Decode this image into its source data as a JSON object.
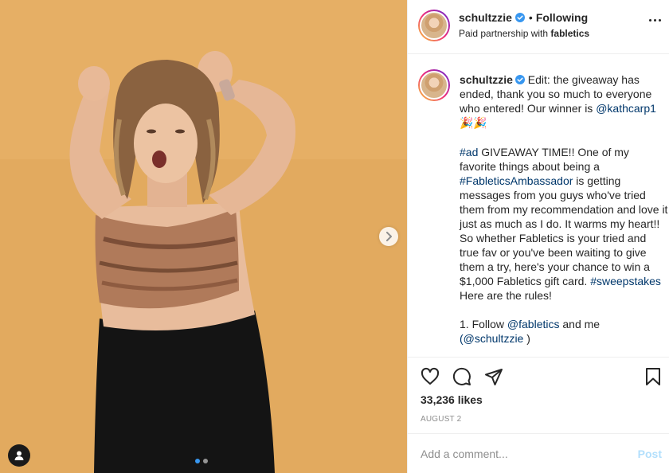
{
  "post": {
    "username": "schultzzie",
    "follow_status": "Following",
    "bullet": "•",
    "partnership_prefix": "Paid partnership with",
    "partner": "fabletics",
    "more_label": "More options",
    "likes": "33,236 likes",
    "date": "AUGUST 2"
  },
  "caption": {
    "username": "schultzzie",
    "p1_text": " Edit: the giveaway has ended, thank you so much to everyone who entered! Our winner is ",
    "p1_mention": "@kathcarp1",
    "p1_emoji": "🎉🎉",
    "p2_hashtag1": "#ad",
    "p2_text1": " GIVEAWAY TIME!! One of my favorite things about being a ",
    "p2_hashtag2": "#FableticsAmbassador",
    "p2_text2": " is getting messages from you guys who've tried them from my recommendation and love it just as much as I do. It warms my heart!! So whether Fabletics is your tried and true fav or you've been waiting to give them a try, here's your chance to win a $1,000 Fabletics gift card. ",
    "p2_hashtag3": "#sweepstakes",
    "p2_text3": " Here are the rules!",
    "p3_text1": "1. Follow ",
    "p3_mention1": "@fabletics",
    "p3_text2": " and me",
    "p3_mention2": "(@schultzzie",
    "p3_text3": " )"
  },
  "comment_box": {
    "placeholder": "Add a comment...",
    "post_label": "Post"
  },
  "carousel": {
    "current": 1,
    "total": 2
  },
  "colors": {
    "verified": "#3897f0",
    "link": "#00376b",
    "post_disabled": "#b2dffc",
    "wall": "#e3ac60"
  },
  "icons": {
    "like": "heart-icon",
    "comment": "comment-icon",
    "share": "paper-plane-icon",
    "save": "bookmark-icon",
    "next": "chevron-right-icon",
    "tag": "user-tag-icon"
  }
}
